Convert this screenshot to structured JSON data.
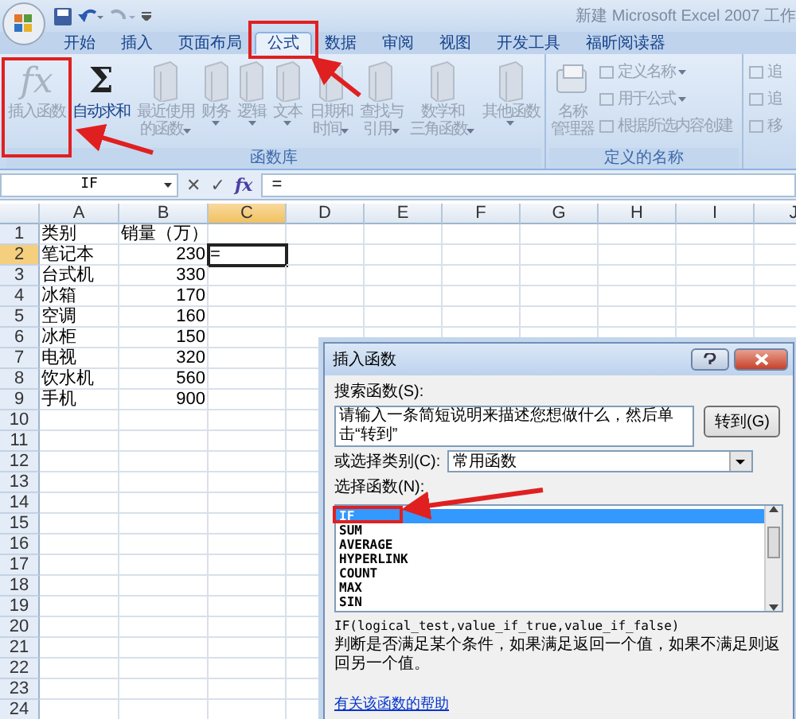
{
  "window": {
    "title": "新建 Microsoft Excel 2007 工作"
  },
  "tabs": [
    {
      "label": "开始",
      "selected": false
    },
    {
      "label": "插入",
      "selected": false
    },
    {
      "label": "页面布局",
      "selected": false
    },
    {
      "label": "公式",
      "selected": true
    },
    {
      "label": "数据",
      "selected": false
    },
    {
      "label": "审阅",
      "selected": false
    },
    {
      "label": "视图",
      "selected": false
    },
    {
      "label": "开发工具",
      "selected": false
    },
    {
      "label": "福昕阅读器",
      "selected": false
    }
  ],
  "ribbon": {
    "groups": [
      {
        "label": "函数库",
        "buttons": [
          {
            "kind": "glyph",
            "icon": "fx",
            "lines": [
              "插入函数"
            ],
            "dropdown": false,
            "disabled": true
          },
          {
            "kind": "glyph",
            "icon": "Σ",
            "lines": [
              "自动求和"
            ],
            "dropdown": false,
            "disabled": false
          },
          {
            "kind": "book",
            "lines": [
              "最近使用",
              "的函数"
            ],
            "dropdown": true,
            "disabled": true
          },
          {
            "kind": "book",
            "lines": [
              "财务"
            ],
            "dropdown": true,
            "disabled": true
          },
          {
            "kind": "book",
            "lines": [
              "逻辑"
            ],
            "dropdown": true,
            "disabled": true
          },
          {
            "kind": "book",
            "lines": [
              "文本"
            ],
            "dropdown": true,
            "disabled": true
          },
          {
            "kind": "book",
            "lines": [
              "日期和",
              "时间"
            ],
            "dropdown": true,
            "disabled": true
          },
          {
            "kind": "book",
            "lines": [
              "查找与",
              "引用"
            ],
            "dropdown": true,
            "disabled": true
          },
          {
            "kind": "book",
            "lines": [
              "数学和",
              "三角函数"
            ],
            "dropdown": true,
            "disabled": true
          },
          {
            "kind": "book",
            "lines": [
              "其他函数"
            ],
            "dropdown": true,
            "disabled": true
          }
        ]
      },
      {
        "label": "定义的名称",
        "buttons": [
          {
            "kind": "names",
            "lines": [
              "名称",
              "管理器"
            ],
            "dropdown": false,
            "disabled": true
          }
        ],
        "small_buttons": [
          {
            "label": "定义名称",
            "dropdown": true,
            "disabled": true
          },
          {
            "label": "用于公式",
            "dropdown": true,
            "disabled": true
          },
          {
            "label": "根据所选内容创建",
            "dropdown": false,
            "disabled": true
          }
        ]
      },
      {
        "small_buttons": [
          {
            "label": "追",
            "dropdown": false,
            "disabled": true
          },
          {
            "label": "追",
            "dropdown": false,
            "disabled": true
          },
          {
            "label": "移",
            "dropdown": false,
            "disabled": true
          }
        ]
      }
    ]
  },
  "formula_bar": {
    "name_box": "IF",
    "cancel": "✕",
    "enter": "✓",
    "fx": "fx",
    "formula": "="
  },
  "sheet": {
    "columns": [
      "A",
      "B",
      "C",
      "D",
      "E",
      "F",
      "G",
      "H",
      "I",
      "J"
    ],
    "rows": [
      {
        "number": "1",
        "cells": [
          {
            "text": "类别",
            "kind": "text",
            "selected": false
          },
          {
            "text": "销量（万）",
            "kind": "text",
            "selected": false
          }
        ]
      },
      {
        "number": "2",
        "cells": [
          {
            "text": "笔记本",
            "kind": "text",
            "selected": false
          },
          {
            "text": "230",
            "kind": "number",
            "selected": false
          },
          {
            "text": "=",
            "kind": "text",
            "selected": true
          }
        ]
      },
      {
        "number": "3",
        "cells": [
          {
            "text": "台式机",
            "kind": "text",
            "selected": false
          },
          {
            "text": "330",
            "kind": "number",
            "selected": false
          }
        ]
      },
      {
        "number": "4",
        "cells": [
          {
            "text": "冰箱",
            "kind": "text",
            "selected": false
          },
          {
            "text": "170",
            "kind": "number",
            "selected": false
          }
        ]
      },
      {
        "number": "5",
        "cells": [
          {
            "text": "空调",
            "kind": "text",
            "selected": false
          },
          {
            "text": "160",
            "kind": "number",
            "selected": false
          }
        ]
      },
      {
        "number": "6",
        "cells": [
          {
            "text": "冰柜",
            "kind": "text",
            "selected": false
          },
          {
            "text": "150",
            "kind": "number",
            "selected": false
          }
        ]
      },
      {
        "number": "7",
        "cells": [
          {
            "text": "电视",
            "kind": "text",
            "selected": false
          },
          {
            "text": "320",
            "kind": "number",
            "selected": false
          }
        ]
      },
      {
        "number": "8",
        "cells": [
          {
            "text": "饮水机",
            "kind": "text",
            "selected": false
          },
          {
            "text": "560",
            "kind": "number",
            "selected": false
          }
        ]
      },
      {
        "number": "9",
        "cells": [
          {
            "text": "手机",
            "kind": "text",
            "selected": false
          },
          {
            "text": "900",
            "kind": "number",
            "selected": false
          }
        ]
      },
      {
        "number": "10"
      },
      {
        "number": "11"
      },
      {
        "number": "12"
      },
      {
        "number": "13"
      },
      {
        "number": "14"
      },
      {
        "number": "15"
      },
      {
        "number": "16"
      },
      {
        "number": "17"
      },
      {
        "number": "18"
      },
      {
        "number": "19"
      },
      {
        "number": "20"
      },
      {
        "number": "21"
      },
      {
        "number": "22"
      },
      {
        "number": "23"
      },
      {
        "number": "24"
      }
    ]
  },
  "dialog": {
    "title": "插入函数",
    "search_label": "搜索函数(S):",
    "search_value": "请输入一条简短说明来描述您想做什么，然后单击“转到”",
    "go_button": "转到(G)",
    "category_label": "或选择类别(C):",
    "category_value": "常用函数",
    "list_label": "选择函数(N):",
    "functions": [
      {
        "name": "IF",
        "selected": true
      },
      {
        "name": "SUM",
        "selected": false
      },
      {
        "name": "AVERAGE",
        "selected": false
      },
      {
        "name": "HYPERLINK",
        "selected": false
      },
      {
        "name": "COUNT",
        "selected": false
      },
      {
        "name": "MAX",
        "selected": false
      },
      {
        "name": "SIN",
        "selected": false
      }
    ],
    "syntax": "IF(logical_test,value_if_true,value_if_false)",
    "description": "判断是否满足某个条件，如果满足返回一个值，如果不满足则返回另一个值。",
    "help_link": "有关该函数的帮助"
  }
}
